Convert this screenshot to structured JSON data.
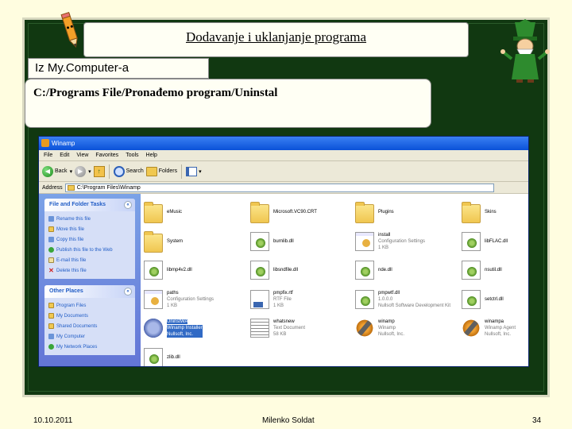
{
  "slide": {
    "title": "Dodavanje i uklanjanje programa",
    "subtitle": "Iz My.Computer-a",
    "path": "C:/Programs File/Pronađemo program/Uninstal",
    "footer_date": "10.10.2011",
    "footer_author": "Milenko Soldat",
    "footer_page": "34"
  },
  "window": {
    "title": "Winamp",
    "menu": [
      "File",
      "Edit",
      "View",
      "Favorites",
      "Tools",
      "Help"
    ],
    "toolbar": {
      "back": "Back",
      "search": "Search",
      "folders": "Folders"
    },
    "address_label": "Address",
    "address_value": "C:\\Program Files\\Winamp"
  },
  "sidebar": {
    "file_tasks_title": "File and Folder Tasks",
    "file_tasks": [
      "Rename this file",
      "Move this file",
      "Copy this file",
      "Publish this file to the Web",
      "E-mail this file",
      "Delete this file"
    ],
    "other_places_title": "Other Places",
    "other_places": [
      "Program Files",
      "My Documents",
      "Shared Documents",
      "My Computer",
      "My Network Places"
    ]
  },
  "files": [
    {
      "name": "eMusic",
      "meta1": "",
      "meta2": "",
      "icon": "folder"
    },
    {
      "name": "Microsoft.VC90.CRT",
      "meta1": "",
      "meta2": "",
      "icon": "folder"
    },
    {
      "name": "Plugins",
      "meta1": "",
      "meta2": "",
      "icon": "folder"
    },
    {
      "name": "Skins",
      "meta1": "",
      "meta2": "",
      "icon": "folder"
    },
    {
      "name": "System",
      "meta1": "",
      "meta2": "",
      "icon": "folder"
    },
    {
      "name": "burnlib.dll",
      "meta1": "",
      "meta2": "",
      "icon": "dll"
    },
    {
      "name": "install",
      "meta1": "Configuration Settings",
      "meta2": "1 KB",
      "icon": "ini"
    },
    {
      "name": "libFLAC.dll",
      "meta1": "",
      "meta2": "",
      "icon": "dll"
    },
    {
      "name": "libmp4v2.dll",
      "meta1": "",
      "meta2": "",
      "icon": "dll"
    },
    {
      "name": "libsndfile.dll",
      "meta1": "",
      "meta2": "",
      "icon": "dll"
    },
    {
      "name": "nde.dll",
      "meta1": "",
      "meta2": "",
      "icon": "dll"
    },
    {
      "name": "nsutil.dll",
      "meta1": "",
      "meta2": "",
      "icon": "dll"
    },
    {
      "name": "paths",
      "meta1": "Configuration Settings",
      "meta2": "1 KB",
      "icon": "ini"
    },
    {
      "name": "pmpfix.rtf",
      "meta1": "RTF File",
      "meta2": "1 KB",
      "icon": "rtf"
    },
    {
      "name": "pmpwtf.dll",
      "meta1": "1.0.0.0",
      "meta2": "Nullsoft Software Development Kit",
      "icon": "dll"
    },
    {
      "name": "setctrl.dll",
      "meta1": "",
      "meta2": "",
      "icon": "dll"
    },
    {
      "name": "UninstWA",
      "meta1": "Winamp Installer",
      "meta2": "Nullsoft, Inc.",
      "icon": "uninst",
      "selected": true
    },
    {
      "name": "whatsnew",
      "meta1": "Text Document",
      "meta2": "58 KB",
      "icon": "txt"
    },
    {
      "name": "winamp",
      "meta1": "Winamp",
      "meta2": "Nullsoft, Inc.",
      "icon": "exe"
    },
    {
      "name": "winampa",
      "meta1": "Winamp Agent",
      "meta2": "Nullsoft, Inc.",
      "icon": "exe"
    },
    {
      "name": "zlib.dll",
      "meta1": "",
      "meta2": "",
      "icon": "dll"
    }
  ]
}
